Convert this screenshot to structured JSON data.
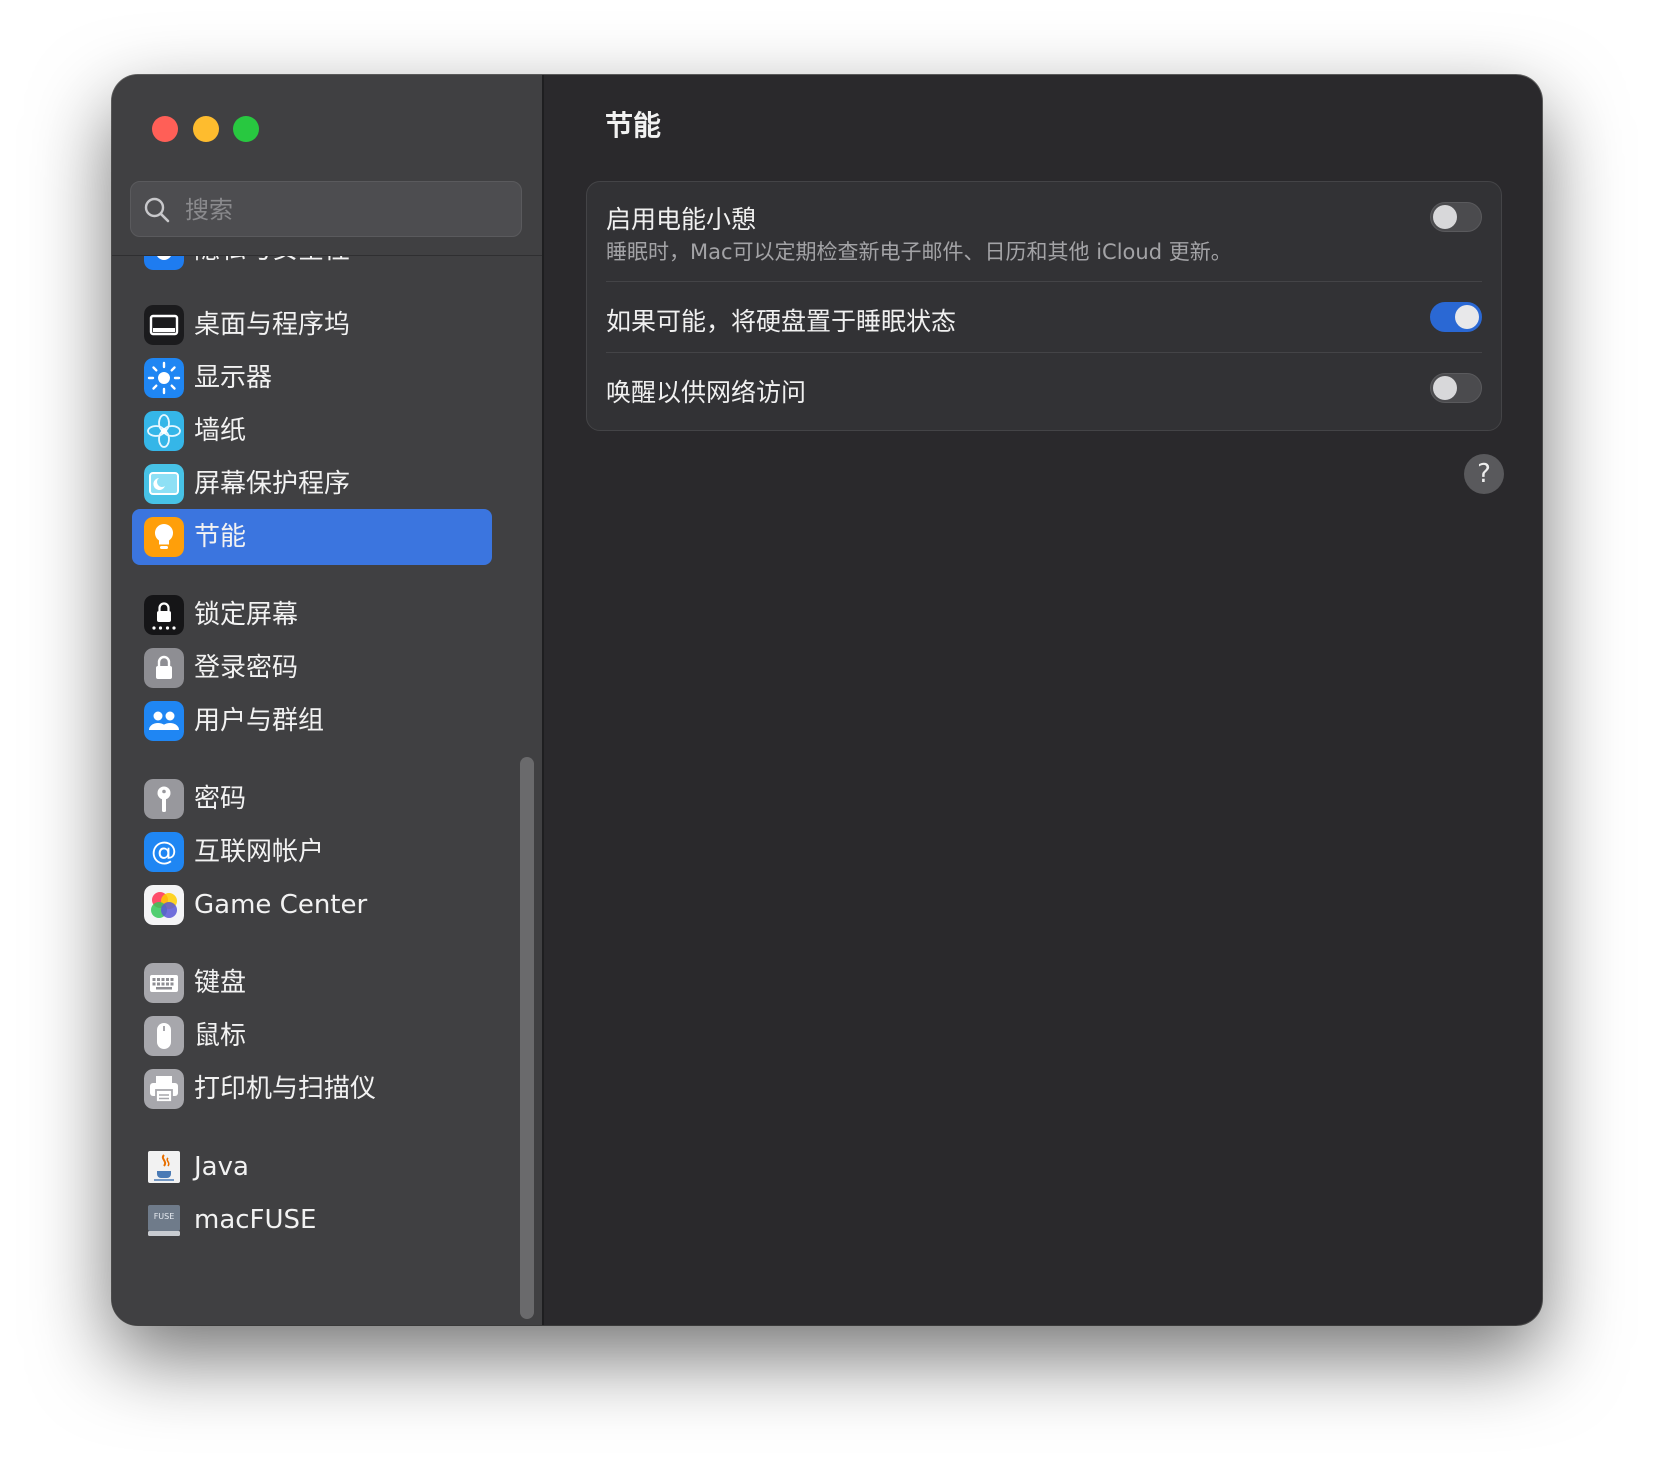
{
  "window": {
    "title": "节能"
  },
  "search": {
    "placeholder": "搜索",
    "value": ""
  },
  "sidebar": {
    "items": [
      {
        "label": "隐私与安全性",
        "icon": "hand-privacy-icon",
        "partially_hidden": true
      },
      {
        "label": "桌面与程序坞",
        "icon": "dock-icon"
      },
      {
        "label": "显示器",
        "icon": "display-brightness-icon"
      },
      {
        "label": "墙纸",
        "icon": "wallpaper-flower-icon"
      },
      {
        "label": "屏幕保护程序",
        "icon": "screensaver-icon"
      },
      {
        "label": "节能",
        "icon": "lightbulb-icon",
        "selected": true
      },
      {
        "label": "锁定屏幕",
        "icon": "lock-screen-icon"
      },
      {
        "label": "登录密码",
        "icon": "lock-icon"
      },
      {
        "label": "用户与群组",
        "icon": "users-icon"
      },
      {
        "label": "密码",
        "icon": "key-icon"
      },
      {
        "label": "互联网帐户",
        "icon": "at-sign-icon"
      },
      {
        "label": "Game Center",
        "icon": "game-center-icon"
      },
      {
        "label": "键盘",
        "icon": "keyboard-icon"
      },
      {
        "label": "鼠标",
        "icon": "mouse-icon"
      },
      {
        "label": "打印机与扫描仪",
        "icon": "printer-icon"
      },
      {
        "label": "Java",
        "icon": "java-icon"
      },
      {
        "label": "macFUSE",
        "icon": "macfuse-drive-icon"
      }
    ]
  },
  "settings": {
    "rows": [
      {
        "title": "启用电能小憩",
        "subtitle": "睡眠时，Mac可以定期检查新电子邮件、日历和其他 iCloud 更新。",
        "enabled": false
      },
      {
        "title": "如果可能，将硬盘置于睡眠状态",
        "enabled": true
      },
      {
        "title": "唤醒以供网络访问",
        "enabled": false
      }
    ]
  },
  "help": {
    "label": "?"
  },
  "colors": {
    "accent": "#3b75df",
    "toggle_on": "#2a68d4",
    "sidebar_bg": "#404042",
    "content_bg": "#2a292c",
    "close": "#ff5f57",
    "minimize": "#febc2e",
    "maximize": "#28c840"
  }
}
